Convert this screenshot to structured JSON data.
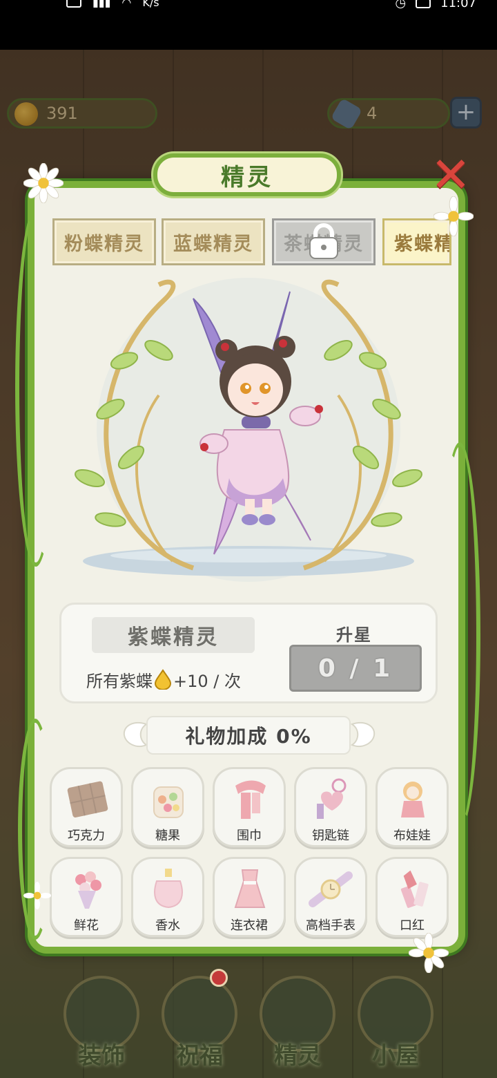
{
  "status_bar": {
    "speed": "K/s",
    "time": "11:07"
  },
  "resources": {
    "drops": "391",
    "gems": "4",
    "plus": "+"
  },
  "modal": {
    "title": "精灵",
    "close": "✕",
    "tabs": [
      {
        "label": "粉蝶精灵",
        "state": "normal"
      },
      {
        "label": "蓝蝶精灵",
        "state": "normal"
      },
      {
        "label": "茶蝶精灵",
        "state": "locked"
      },
      {
        "label": "紫蝶精",
        "state": "active"
      }
    ],
    "sprite": {
      "name": "紫蝶精灵",
      "bonus_prefix": "所有紫蝶",
      "bonus_suffix": "+10 / 次",
      "upgrade_label": "升星",
      "upgrade_progress": "0 / 1"
    },
    "gift_bonus": "礼物加成 0%",
    "gifts": [
      {
        "label": "巧克力",
        "icon": "chocolate-icon"
      },
      {
        "label": "糖果",
        "icon": "candy-icon"
      },
      {
        "label": "围巾",
        "icon": "scarf-icon"
      },
      {
        "label": "钥匙链",
        "icon": "keychain-icon"
      },
      {
        "label": "布娃娃",
        "icon": "doll-icon"
      },
      {
        "label": "鲜花",
        "icon": "flower-icon"
      },
      {
        "label": "香水",
        "icon": "perfume-icon"
      },
      {
        "label": "连衣裙",
        "icon": "dress-icon"
      },
      {
        "label": "高档手表",
        "icon": "watch-icon"
      },
      {
        "label": "口红",
        "icon": "lipstick-icon"
      }
    ]
  },
  "bottom_nav": [
    {
      "label": "装饰"
    },
    {
      "label": "祝福"
    },
    {
      "label": "精灵"
    },
    {
      "label": "小屋"
    }
  ],
  "colors": {
    "vine": "#7bb03a",
    "panel": "#f2f1e7",
    "close": "#d9453c"
  }
}
